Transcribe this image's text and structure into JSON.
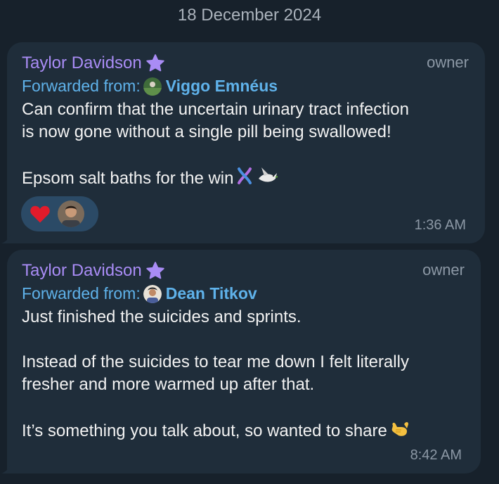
{
  "date_separator": "18 December 2024",
  "messages": [
    {
      "sender": "Taylor Davidson",
      "role": "owner",
      "forwarded_prefix": "Forwarded from:",
      "forwarded_name": "Viggo Emnéus",
      "text": "Can confirm that the uncertain urinary tract infection\nis now gone without a single pill being swallowed!\n\nEpsom salt baths for the win",
      "reaction": "heart",
      "time": "1:36 AM"
    },
    {
      "sender": "Taylor Davidson",
      "role": "owner",
      "forwarded_prefix": "Forwarded from:",
      "forwarded_name": "Dean Titkov",
      "text": "Just finished the suicides and sprints.\n\nInstead of the suicides to tear me down I felt literally\nfresher and more warmed up after that.\n\nIt’s something you talk about, so wanted to share",
      "time": "8:42 AM"
    }
  ],
  "colors": {
    "background": "#17212b",
    "bubble": "#1f2d3a",
    "sender": "#a98cf5",
    "forward": "#5fb2ea",
    "meta": "#8c98a5"
  }
}
